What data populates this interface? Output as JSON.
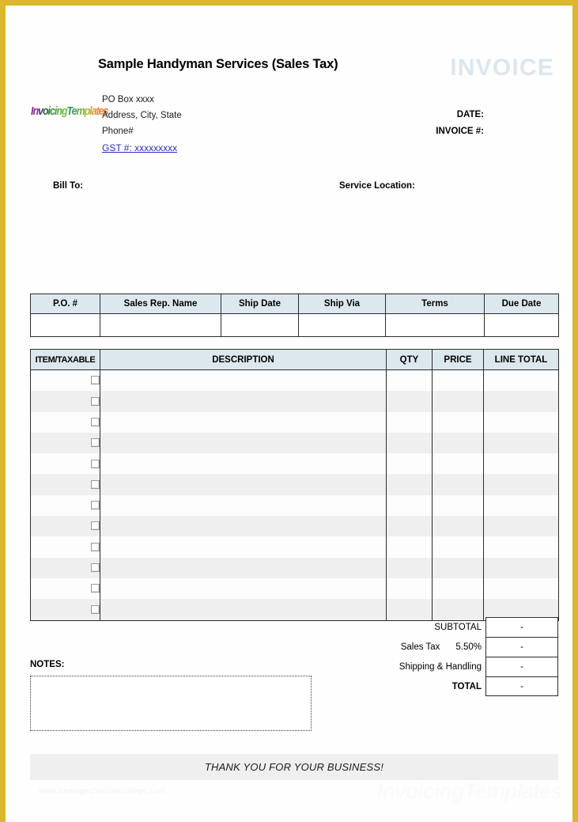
{
  "page": {
    "border_color": "#dcb62c",
    "background": "#ffffff"
  },
  "header": {
    "company_title": "Sample Handyman Services (Sales Tax)",
    "invoice_word": "INVOICE",
    "invoice_word_color": "#dce6ef",
    "logo": {
      "name": "invoicing-templates-logo",
      "parts": [
        {
          "text": "I",
          "color": "#7b2f8e"
        },
        {
          "text": "n",
          "color": "#8e2f8e"
        },
        {
          "text": "v",
          "color": "#4f2f8e"
        },
        {
          "text": "o",
          "color": "#2f5f2f"
        },
        {
          "text": "i",
          "color": "#2f7f3f"
        },
        {
          "text": "c",
          "color": "#3f8f3f"
        },
        {
          "text": "i",
          "color": "#4f9f3f"
        },
        {
          "text": "n",
          "color": "#5faf3f"
        },
        {
          "text": "g",
          "color": "#6fbf3f"
        },
        {
          "text": "T",
          "color": "#2f8f6f"
        },
        {
          "text": "e",
          "color": "#3f9f5f"
        },
        {
          "text": "m",
          "color": "#6faf3f"
        },
        {
          "text": "p",
          "color": "#9fbf2f"
        },
        {
          "text": "l",
          "color": "#cfa92f"
        },
        {
          "text": "a",
          "color": "#e8952f"
        },
        {
          "text": "t",
          "color": "#e8852f"
        },
        {
          "text": "e",
          "color": "#e87a2f"
        },
        {
          "text": "s",
          "color": "#e8702f"
        }
      ]
    },
    "address_lines": [
      "PO Box xxxx",
      "Address, City, State",
      "Phone#"
    ],
    "gst_line": "GST #: xxxxxxxxx",
    "gst_color": "#2b2bc8",
    "date_label": "DATE:",
    "invoice_number_label": "INVOICE #:",
    "date_value": "",
    "invoice_number_value": ""
  },
  "parties": {
    "bill_to_label": "Bill To:",
    "bill_to_value": "",
    "service_location_label": "Service Location:",
    "service_location_value": ""
  },
  "meta_table": {
    "headers": [
      "P.O. #",
      "Sales Rep. Name",
      "Ship Date",
      "Ship Via",
      "Terms",
      "Due Date"
    ],
    "values": [
      "",
      "",
      "",
      "",
      "",
      ""
    ]
  },
  "items_table": {
    "headers": [
      "ITEM/TAXABLE",
      "DESCRIPTION",
      "QTY",
      "PRICE",
      "LINE TOTAL"
    ],
    "row_count": 12,
    "rows": [
      {
        "taxable": false,
        "description": "",
        "qty": "",
        "price": "",
        "line_total": ""
      },
      {
        "taxable": false,
        "description": "",
        "qty": "",
        "price": "",
        "line_total": ""
      },
      {
        "taxable": false,
        "description": "",
        "qty": "",
        "price": "",
        "line_total": ""
      },
      {
        "taxable": false,
        "description": "",
        "qty": "",
        "price": "",
        "line_total": ""
      },
      {
        "taxable": false,
        "description": "",
        "qty": "",
        "price": "",
        "line_total": ""
      },
      {
        "taxable": false,
        "description": "",
        "qty": "",
        "price": "",
        "line_total": ""
      },
      {
        "taxable": false,
        "description": "",
        "qty": "",
        "price": "",
        "line_total": ""
      },
      {
        "taxable": false,
        "description": "",
        "qty": "",
        "price": "",
        "line_total": ""
      },
      {
        "taxable": false,
        "description": "",
        "qty": "",
        "price": "",
        "line_total": ""
      },
      {
        "taxable": false,
        "description": "",
        "qty": "",
        "price": "",
        "line_total": ""
      },
      {
        "taxable": false,
        "description": "",
        "qty": "",
        "price": "",
        "line_total": ""
      },
      {
        "taxable": false,
        "description": "",
        "qty": "",
        "price": "",
        "line_total": ""
      }
    ]
  },
  "totals": {
    "subtotal_label": "SUBTOTAL",
    "subtotal_value": "-",
    "sales_tax_label": "Sales Tax",
    "sales_tax_rate": "5.50%",
    "sales_tax_value": "-",
    "shipping_label": "Shipping & Handling",
    "shipping_value": "-",
    "total_label": "TOTAL",
    "total_value": "-"
  },
  "notes": {
    "label": "NOTES:",
    "value": ""
  },
  "footer": {
    "thank_you": "THANK YOU FOR YOUR BUSINESS!",
    "watermark_left": "www.heritagechristiancollege.com",
    "watermark_right": "InvoicingTemplates"
  }
}
